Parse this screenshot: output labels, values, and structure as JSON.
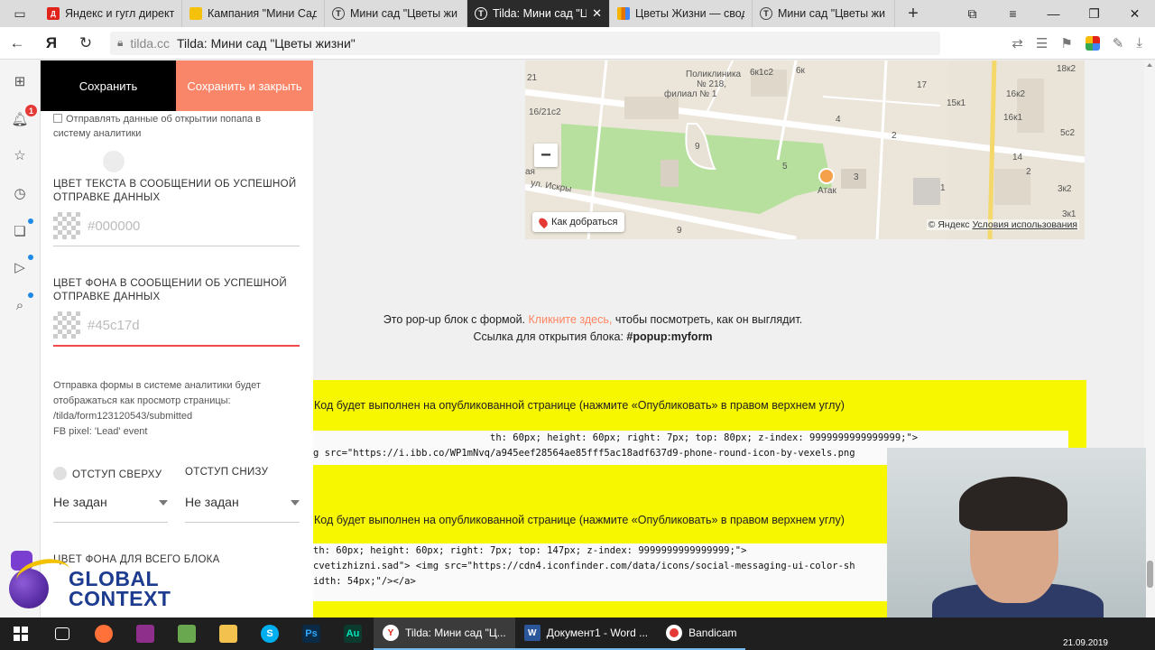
{
  "browser": {
    "tabs": [
      {
        "label": "Яндекс и гугл директ",
        "icon": "yandex-direct-icon"
      },
      {
        "label": "Кампания \"Мини Сад",
        "icon": "google-ads-icon"
      },
      {
        "label": "Мини сад \"Цветы жи",
        "icon": "tilda-icon"
      },
      {
        "label": "Tilda: Мини сад \"Ц",
        "icon": "tilda-icon",
        "active": true
      },
      {
        "label": "Цветы Жизни — свод",
        "icon": "google-analytics-icon"
      },
      {
        "label": "Мини сад \"Цветы жи",
        "icon": "tilda-icon"
      }
    ],
    "address": {
      "domain": "tilda.cc",
      "page_title": "Tilda: Мини сад \"Цветы жизни\""
    },
    "notification_count": "1"
  },
  "panel": {
    "save_label": "Сохранить",
    "save_close_label": "Сохранить и закрыть",
    "analytics_checkbox_label": "Отправлять данные об открытии попапа в систему аналитики",
    "success_text_color_label": "ЦВЕТ ТЕКСТА В СООБЩЕНИИ ОБ УСПЕШНОЙ ОТПРАВКЕ ДАННЫХ",
    "success_text_color_value": "#000000",
    "success_bg_color_label": "ЦВЕТ ФОНА В СООБЩЕНИИ ОБ УСПЕШНОЙ ОТПРАВКЕ ДАННЫХ",
    "success_bg_color_value": "#45c17d",
    "analytics_note_1": "Отправка формы в системе аналитики будет отображаться как просмотр страницы:",
    "analytics_note_2": "/tilda/form123120543/submitted",
    "analytics_note_3": "FB pixel: 'Lead' event",
    "padding_top_label": "ОТСТУП СВЕРХУ",
    "padding_bottom_label": "ОТСТУП СНИЗУ",
    "padding_top_value": "Не задан",
    "padding_bottom_value": "Не задан",
    "block_bg_label": "ЦВЕТ ФОНА ДЛЯ ВСЕГО БЛОКА"
  },
  "logo": {
    "line1": "GLOBAL",
    "line2": "CONTEXT"
  },
  "map": {
    "labels": {
      "clinic_1": "Поликлиника",
      "clinic_2": "№ 218,",
      "clinic_3": "филиал № 1",
      "street": "ул. Искры",
      "shop": "Атак",
      "b1": "6к1с2",
      "b2": "6к",
      "b3": "18к2",
      "b4": "16к2",
      "b5": "16к1",
      "b6": "15к1",
      "b7": "5с2",
      "b8": "14",
      "b9": "3к2",
      "b10": "3к1",
      "b11": "16/21с2",
      "b12": "21",
      "b13": "17",
      "b14": "4",
      "b15": "2",
      "b16": "9",
      "b17": "5",
      "b18": "3",
      "b19": "1",
      "b20": "2",
      "b21": "9",
      "b22": "ая"
    },
    "route_label": "Как добраться",
    "copyright": "© Яндекс",
    "terms_link": "Условия использования"
  },
  "content": {
    "popup_text_1": "Это pop-up блок с формой.",
    "popup_link": "Кликните здесь,",
    "popup_text_2": "чтобы посмотреть, как он выглядит.",
    "popup_text_3": "Ссылка для открытия блока:",
    "popup_anchor": "#popup:myform",
    "code_notice_1": "Код будет выполнен на опубликованной странице (нажмите «Опубликовать» в правом верхнем углу)",
    "code_1_line_1": "th: 60px; height: 60px; right: 7px; top: 80px; z-index: 9999999999999999;\">",
    "code_1_line_2": "g src=\"https://i.ibb.co/WP1mNvq/a945eef28564ae85fff5ac18adf637d9-phone-round-icon-by-vexels.png",
    "code_notice_2": "Код будет выполнен на опубликованной странице (нажмите «Опубликовать» в правом верхнем углу)",
    "code_2_line_1": "th: 60px; height: 60px; right: 7px; top: 147px; z-index: 9999999999999999;\">",
    "code_2_line_2": "cvetizhizni.sad\"> <img src=\"https://cdn4.iconfinder.com/data/icons/social-messaging-ui-color-sh",
    "code_2_line_3": "idth: 54px;\"/></a>"
  },
  "taskbar": {
    "apps": [
      {
        "label": "Tilda: Мини сад \"Ц...",
        "icon": "yandex-browser-icon",
        "active": true
      },
      {
        "label": "Документ1 - Word ...",
        "icon": "word-icon"
      },
      {
        "label": "Bandicam",
        "icon": "bandicam-icon"
      }
    ],
    "date": "21.09.2019"
  },
  "colors": {
    "accent": "#fa8669",
    "yellow_block": "#f7f700",
    "link": "#ff8562",
    "error_line": "#f04a4a"
  }
}
